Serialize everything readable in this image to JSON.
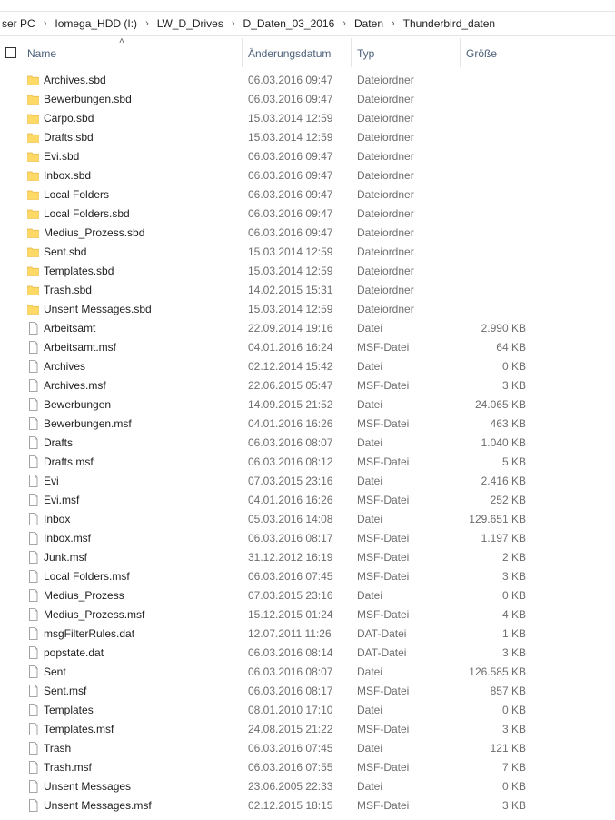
{
  "breadcrumb": [
    "ser PC",
    "Iomega_HDD (I:)",
    "LW_D_Drives",
    "D_Daten_03_2016",
    "Daten",
    "Thunderbird_daten"
  ],
  "columns": {
    "name": "Name",
    "date": "Änderungsdatum",
    "type": "Typ",
    "size": "Größe"
  },
  "colors": {
    "folder": "#ffd966",
    "folder_edge": "#e3b341",
    "header_text": "#4c607a"
  },
  "files": [
    {
      "name": "Archives.sbd",
      "date": "06.03.2016 09:47",
      "type": "Dateiordner",
      "size": "",
      "icon": "folder-icon"
    },
    {
      "name": "Bewerbungen.sbd",
      "date": "06.03.2016 09:47",
      "type": "Dateiordner",
      "size": "",
      "icon": "folder-icon"
    },
    {
      "name": "Carpo.sbd",
      "date": "15.03.2014 12:59",
      "type": "Dateiordner",
      "size": "",
      "icon": "folder-icon"
    },
    {
      "name": "Drafts.sbd",
      "date": "15.03.2014 12:59",
      "type": "Dateiordner",
      "size": "",
      "icon": "folder-icon"
    },
    {
      "name": "Evi.sbd",
      "date": "06.03.2016 09:47",
      "type": "Dateiordner",
      "size": "",
      "icon": "folder-icon"
    },
    {
      "name": "Inbox.sbd",
      "date": "06.03.2016 09:47",
      "type": "Dateiordner",
      "size": "",
      "icon": "folder-icon"
    },
    {
      "name": "Local Folders",
      "date": "06.03.2016 09:47",
      "type": "Dateiordner",
      "size": "",
      "icon": "folder-icon"
    },
    {
      "name": "Local Folders.sbd",
      "date": "06.03.2016 09:47",
      "type": "Dateiordner",
      "size": "",
      "icon": "folder-icon"
    },
    {
      "name": "Medius_Prozess.sbd",
      "date": "06.03.2016 09:47",
      "type": "Dateiordner",
      "size": "",
      "icon": "folder-icon"
    },
    {
      "name": "Sent.sbd",
      "date": "15.03.2014 12:59",
      "type": "Dateiordner",
      "size": "",
      "icon": "folder-icon"
    },
    {
      "name": "Templates.sbd",
      "date": "15.03.2014 12:59",
      "type": "Dateiordner",
      "size": "",
      "icon": "folder-icon"
    },
    {
      "name": "Trash.sbd",
      "date": "14.02.2015 15:31",
      "type": "Dateiordner",
      "size": "",
      "icon": "folder-icon"
    },
    {
      "name": "Unsent Messages.sbd",
      "date": "15.03.2014 12:59",
      "type": "Dateiordner",
      "size": "",
      "icon": "folder-icon"
    },
    {
      "name": "Arbeitsamt",
      "date": "22.09.2014 19:16",
      "type": "Datei",
      "size": "2.990 KB",
      "icon": "file-icon"
    },
    {
      "name": "Arbeitsamt.msf",
      "date": "04.01.2016 16:24",
      "type": "MSF-Datei",
      "size": "64 KB",
      "icon": "file-icon"
    },
    {
      "name": "Archives",
      "date": "02.12.2014 15:42",
      "type": "Datei",
      "size": "0 KB",
      "icon": "file-icon"
    },
    {
      "name": "Archives.msf",
      "date": "22.06.2015 05:47",
      "type": "MSF-Datei",
      "size": "3 KB",
      "icon": "file-icon"
    },
    {
      "name": "Bewerbungen",
      "date": "14.09.2015 21:52",
      "type": "Datei",
      "size": "24.065 KB",
      "icon": "file-icon"
    },
    {
      "name": "Bewerbungen.msf",
      "date": "04.01.2016 16:26",
      "type": "MSF-Datei",
      "size": "463 KB",
      "icon": "file-icon"
    },
    {
      "name": "Drafts",
      "date": "06.03.2016 08:07",
      "type": "Datei",
      "size": "1.040 KB",
      "icon": "file-icon"
    },
    {
      "name": "Drafts.msf",
      "date": "06.03.2016 08:12",
      "type": "MSF-Datei",
      "size": "5 KB",
      "icon": "file-icon"
    },
    {
      "name": "Evi",
      "date": "07.03.2015 23:16",
      "type": "Datei",
      "size": "2.416 KB",
      "icon": "file-icon"
    },
    {
      "name": "Evi.msf",
      "date": "04.01.2016 16:26",
      "type": "MSF-Datei",
      "size": "252 KB",
      "icon": "file-icon"
    },
    {
      "name": "Inbox",
      "date": "05.03.2016 14:08",
      "type": "Datei",
      "size": "129.651 KB",
      "icon": "file-icon"
    },
    {
      "name": "Inbox.msf",
      "date": "06.03.2016 08:17",
      "type": "MSF-Datei",
      "size": "1.197 KB",
      "icon": "file-icon"
    },
    {
      "name": "Junk.msf",
      "date": "31.12.2012 16:19",
      "type": "MSF-Datei",
      "size": "2 KB",
      "icon": "file-icon"
    },
    {
      "name": "Local Folders.msf",
      "date": "06.03.2016 07:45",
      "type": "MSF-Datei",
      "size": "3 KB",
      "icon": "file-icon"
    },
    {
      "name": "Medius_Prozess",
      "date": "07.03.2015 23:16",
      "type": "Datei",
      "size": "0 KB",
      "icon": "file-icon"
    },
    {
      "name": "Medius_Prozess.msf",
      "date": "15.12.2015 01:24",
      "type": "MSF-Datei",
      "size": "4 KB",
      "icon": "file-icon"
    },
    {
      "name": "msgFilterRules.dat",
      "date": "12.07.2011 11:26",
      "type": "DAT-Datei",
      "size": "1 KB",
      "icon": "file-icon"
    },
    {
      "name": "popstate.dat",
      "date": "06.03.2016 08:14",
      "type": "DAT-Datei",
      "size": "3 KB",
      "icon": "file-icon"
    },
    {
      "name": "Sent",
      "date": "06.03.2016 08:07",
      "type": "Datei",
      "size": "126.585 KB",
      "icon": "file-icon"
    },
    {
      "name": "Sent.msf",
      "date": "06.03.2016 08:17",
      "type": "MSF-Datei",
      "size": "857 KB",
      "icon": "file-icon"
    },
    {
      "name": "Templates",
      "date": "08.01.2010 17:10",
      "type": "Datei",
      "size": "0 KB",
      "icon": "file-icon"
    },
    {
      "name": "Templates.msf",
      "date": "24.08.2015 21:22",
      "type": "MSF-Datei",
      "size": "3 KB",
      "icon": "file-icon"
    },
    {
      "name": "Trash",
      "date": "06.03.2016 07:45",
      "type": "Datei",
      "size": "121 KB",
      "icon": "file-icon"
    },
    {
      "name": "Trash.msf",
      "date": "06.03.2016 07:55",
      "type": "MSF-Datei",
      "size": "7 KB",
      "icon": "file-icon"
    },
    {
      "name": "Unsent Messages",
      "date": "23.06.2005 22:33",
      "type": "Datei",
      "size": "0 KB",
      "icon": "file-icon"
    },
    {
      "name": "Unsent Messages.msf",
      "date": "02.12.2015 18:15",
      "type": "MSF-Datei",
      "size": "3 KB",
      "icon": "file-icon"
    }
  ]
}
